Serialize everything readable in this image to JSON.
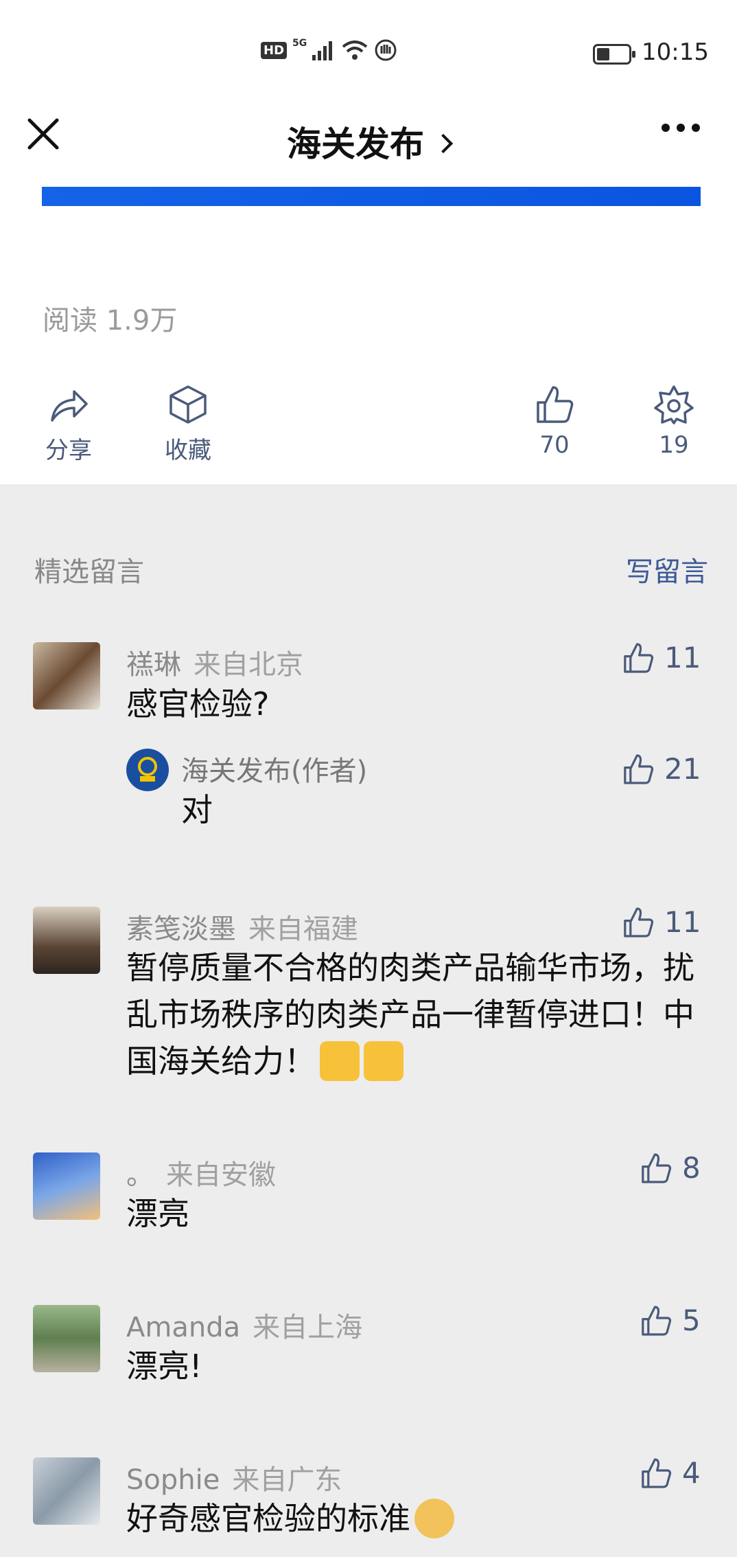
{
  "status_bar": {
    "network": "HD",
    "gen": "5G",
    "time": "10:15"
  },
  "nav": {
    "title": "海关发布"
  },
  "article": {
    "reads": "阅读 1.9万"
  },
  "actions": {
    "share": "分享",
    "collect": "收藏",
    "likes": "70",
    "wow": "19"
  },
  "comments_header": {
    "label": "精选留言",
    "write": "写留言"
  },
  "comments": [
    {
      "name": "禚琳",
      "location": "来自北京",
      "text": "感官检验?",
      "likes": "11",
      "reply": {
        "name": "海关发布(作者)",
        "text": "对",
        "likes": "21"
      }
    },
    {
      "name": "素笺淡墨",
      "location": "来自福建",
      "text": "暂停质量不合格的肉类产品输华市场，扰乱市场秩序的肉类产品一律暂停进口！中国海关给力！",
      "likes": "11"
    },
    {
      "name": "。",
      "location": "来自安徽",
      "text": "漂亮",
      "likes": "8"
    },
    {
      "name": "Amanda",
      "location": "来自上海",
      "text": "漂亮!",
      "likes": "5"
    },
    {
      "name": "Sophie",
      "location": "来自广东",
      "text": "好奇感官检验的标准",
      "likes": "4"
    }
  ],
  "colors": {
    "accent_blue": "#1463e8",
    "link": "#3c5a96",
    "bg": "#ededed"
  }
}
